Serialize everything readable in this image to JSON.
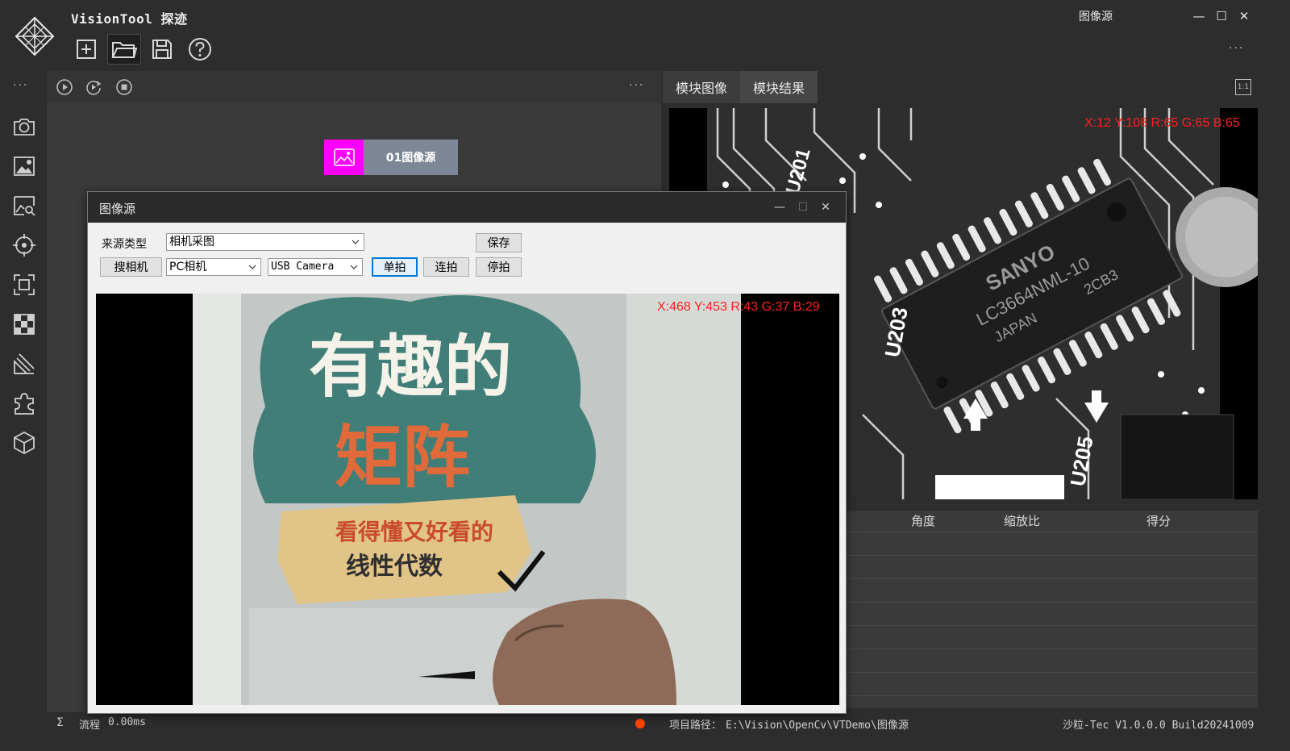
{
  "app": {
    "title": "VisionTool 探迹",
    "window_title": "图像源",
    "more": "···"
  },
  "toolbar": {
    "new_icon": "new-file-icon",
    "open_icon": "open-folder-icon",
    "save_icon": "save-icon",
    "help_icon": "help-icon"
  },
  "sidebar": {
    "more": "···",
    "items": [
      "camera-icon",
      "image-settings-icon",
      "image-search-icon",
      "target-icon",
      "roi-icon",
      "pattern-icon",
      "measure-icon",
      "plugin-icon",
      "cube-icon"
    ]
  },
  "flow": {
    "more": "···",
    "node_label": "01图像源"
  },
  "right": {
    "tabs": [
      {
        "label": "模块图像",
        "active": true
      },
      {
        "label": "模块结果",
        "active": false
      }
    ],
    "zoom_label": "1:1",
    "pixel_info": "X:12 Y:108  R:65 G:65 B:65",
    "table_headers": [
      "角度",
      "缩放比",
      "得分"
    ],
    "chip_text": [
      "SANYO",
      "LC3664NML-10",
      "JAPAN",
      "2CB3"
    ],
    "board_labels": [
      "U203",
      "U205",
      "U201"
    ]
  },
  "status": {
    "sigma": "Σ",
    "flow_label": "流程",
    "time": "0.00ms",
    "path_label": "项目路径：",
    "path_value": "E:\\Vision\\OpenCv\\VTDemo\\图像源",
    "version": "沙粒-Tec V1.0.0.0 Build20241009",
    "indicator_color": "#ff4500"
  },
  "dialog": {
    "title": "图像源",
    "source_type_label": "来源类型",
    "source_type_value": "相机采图",
    "save_button": "保存",
    "search_camera_button": "搜相机",
    "camera_type_value": "PC相机",
    "camera_value": "USB Camera",
    "single_shot_button": "单拍",
    "continuous_button": "连拍",
    "stop_button": "停拍",
    "pixel_info": "X:468 Y:453  R:43 G:37 B:29",
    "book": {
      "title_line1": "有趣的",
      "title_line2": "矩阵",
      "subtitle1": "看得懂又好看的",
      "subtitle2": "线性代数"
    }
  }
}
